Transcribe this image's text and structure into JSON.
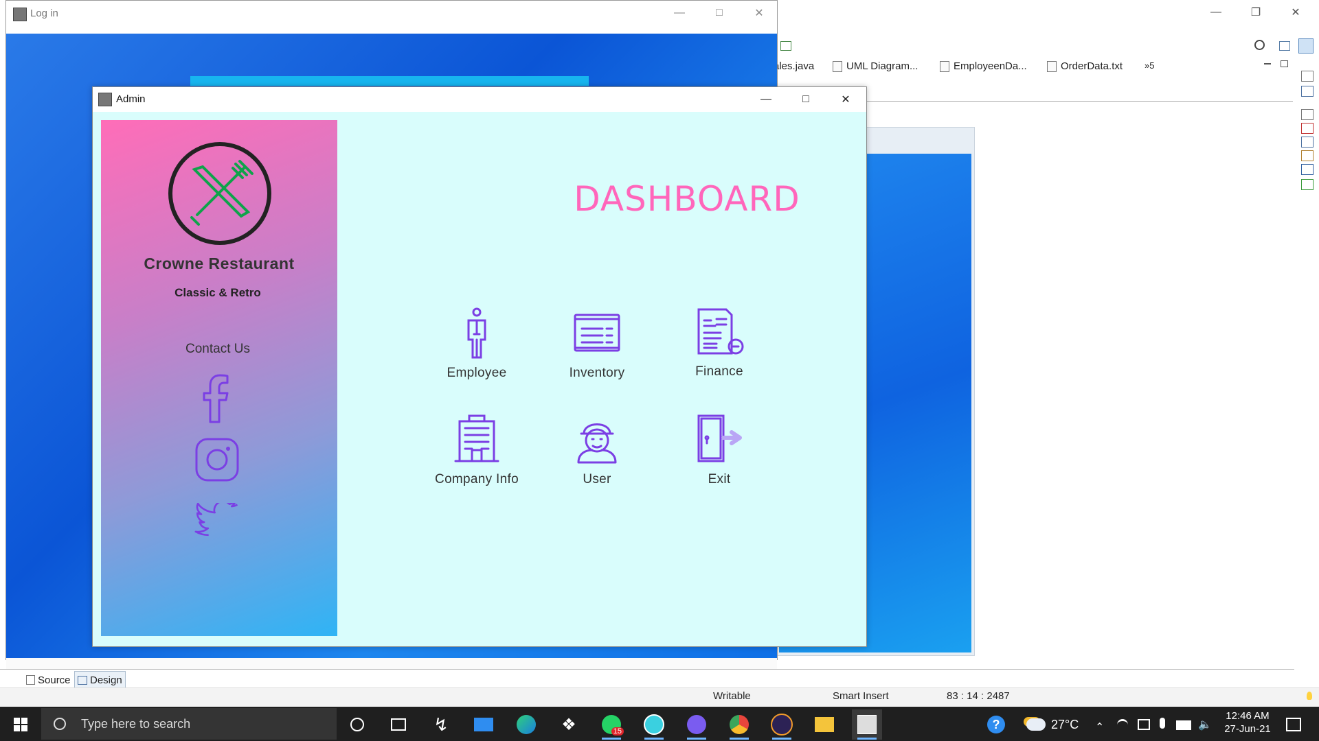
{
  "login_window": {
    "title": "Log in"
  },
  "ide": {
    "tabs": [
      {
        "label": "ales.java"
      },
      {
        "label": "UML Diagram..."
      },
      {
        "label": "EmployeenDa..."
      },
      {
        "label": "OrderData.txt"
      },
      {
        "label": "»5"
      }
    ],
    "bottom_tabs": {
      "source": "Source",
      "design": "Design"
    },
    "status": {
      "writable": "Writable",
      "insert_mode": "Smart Insert",
      "position": "83 : 14 : 2487"
    }
  },
  "admin_window": {
    "title": "Admin",
    "sidebar": {
      "restaurant_name": "Crowne Restaurant",
      "tagline": "Classic & Retro",
      "contact_label": "Contact Us",
      "socials": [
        {
          "icon": "facebook-icon"
        },
        {
          "icon": "instagram-icon"
        },
        {
          "icon": "twitter-icon"
        }
      ]
    },
    "dashboard": {
      "title": "DASHBOARD",
      "items": [
        {
          "label": "Employee",
          "icon": "employee-icon"
        },
        {
          "label": "Inventory",
          "icon": "inventory-icon"
        },
        {
          "label": "Finance",
          "icon": "finance-icon"
        },
        {
          "label": "Company Info",
          "icon": "company-icon"
        },
        {
          "label": "User",
          "icon": "user-icon"
        },
        {
          "label": "Exit",
          "icon": "exit-icon"
        }
      ]
    }
  },
  "taskbar": {
    "search_placeholder": "Type here to search",
    "whatsapp_badge": "15",
    "weather": "27°C",
    "time": "12:46 AM",
    "date": "27-Jun-21"
  },
  "colors": {
    "dashboard_bg": "#d9fdfc",
    "title_pink": "#ff66bb",
    "gradient_top": "#ff6fb5",
    "gradient_bottom": "#2fb4f5",
    "icon_purple": "#7b3fe4",
    "taskbar_bg": "#1f1f1f"
  }
}
